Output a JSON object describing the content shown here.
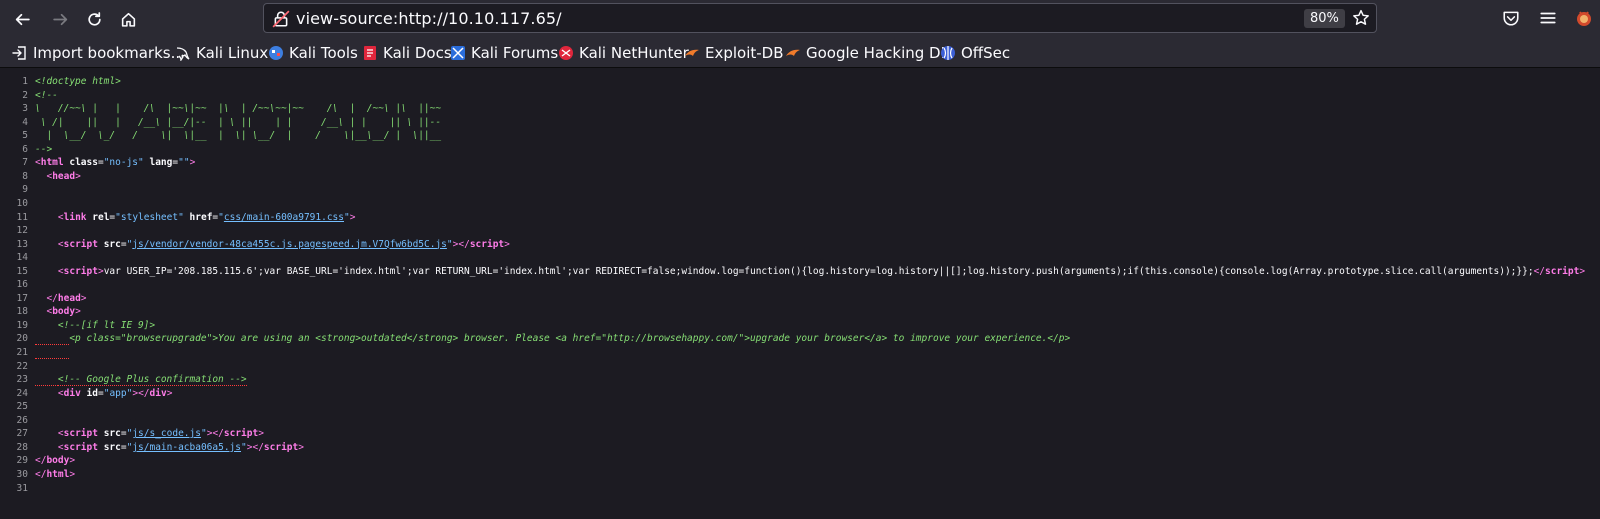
{
  "toolbar": {
    "url": "view-source:http://10.10.117.65/",
    "zoom": "80%"
  },
  "bookmarks": [
    {
      "label": "Import bookmarks...",
      "icon": "import-icon"
    },
    {
      "label": "Kali Linux",
      "icon": "kali-dragon-icon"
    },
    {
      "label": "Kali Tools",
      "icon": "kali-tools-icon"
    },
    {
      "label": "Kali Docs",
      "icon": "kali-docs-icon"
    },
    {
      "label": "Kali Forums",
      "icon": "kali-forums-icon"
    },
    {
      "label": "Kali NetHunter",
      "icon": "kali-nethunter-icon"
    },
    {
      "label": "Exploit-DB",
      "icon": "exploit-db-icon"
    },
    {
      "label": "Google Hacking DB",
      "icon": "ghdb-icon"
    },
    {
      "label": "OffSec",
      "icon": "offsec-icon"
    }
  ],
  "source": {
    "line_numbers": [
      "1",
      "2",
      "3",
      "4",
      "5",
      "6",
      "7",
      "8",
      "9",
      "10",
      "11",
      "12",
      "13",
      "14",
      "15",
      "16",
      "17",
      "18",
      "19",
      "20",
      "21",
      "22",
      "23",
      "24",
      "25",
      "26",
      "27",
      "28",
      "29",
      "30",
      "31"
    ],
    "doctype": "<!doctype html>",
    "comment_open": "<!--",
    "ascii_art": [
      "\\   //~~\\ |   |    /\\  |~~\\|~~  |\\  | /~~\\~~|~~    /\\  |  /~~\\ |\\  ||~~",
      " \\ /|    ||   |   /__\\ |__/|--  | \\ ||    | |     /__\\ | |    || \\ ||--",
      "  |  \\__/  \\_/   /    \\|  \\|__  |  \\| \\__/  |    /    \\|__\\__/ |  \\||__"
    ],
    "comment_close": "-->",
    "html_tag": "html",
    "html_class_attr": "class",
    "html_class_val": "\"no-js\"",
    "html_lang_attr": "lang",
    "html_lang_val": "\"\"",
    "head_tag": "head",
    "link_tag": "link",
    "link_rel_attr": "rel",
    "link_rel_val": "\"stylesheet\"",
    "link_href_attr": "href",
    "link_href_val": "css/main-600a9791.css",
    "script_tag": "script",
    "script_src_attr": "src",
    "script1_src": "js/vendor/vendor-48ca455c.js.pagespeed.jm.V7Qfw6bd5C.js",
    "inline_script": "var USER_IP='208.185.115.6';var BASE_URL='index.html';var RETURN_URL='index.html';var REDIRECT=false;window.log=function(){log.history=log.history||[];log.history.push(arguments);if(this.console){console.log(Array.prototype.slice.call(arguments));}};",
    "body_tag": "body",
    "ie_comment": "<!--[if lt IE 9]>",
    "ie_paragraph": "<p class=\"browserupgrade\">You are using an <strong>outdated</strong> browser. Please <a href=\"http://browsehappy.com/\">upgrade your browser</a> to improve your experience.</p>",
    "gplus_comment": "<!-- Google Plus confirmation -->",
    "div_tag": "div",
    "div_id_attr": "id",
    "div_id_val": "\"app\"",
    "script2_src": "js/s_code.js",
    "script3_src": "js/main-acba06a5.js"
  }
}
